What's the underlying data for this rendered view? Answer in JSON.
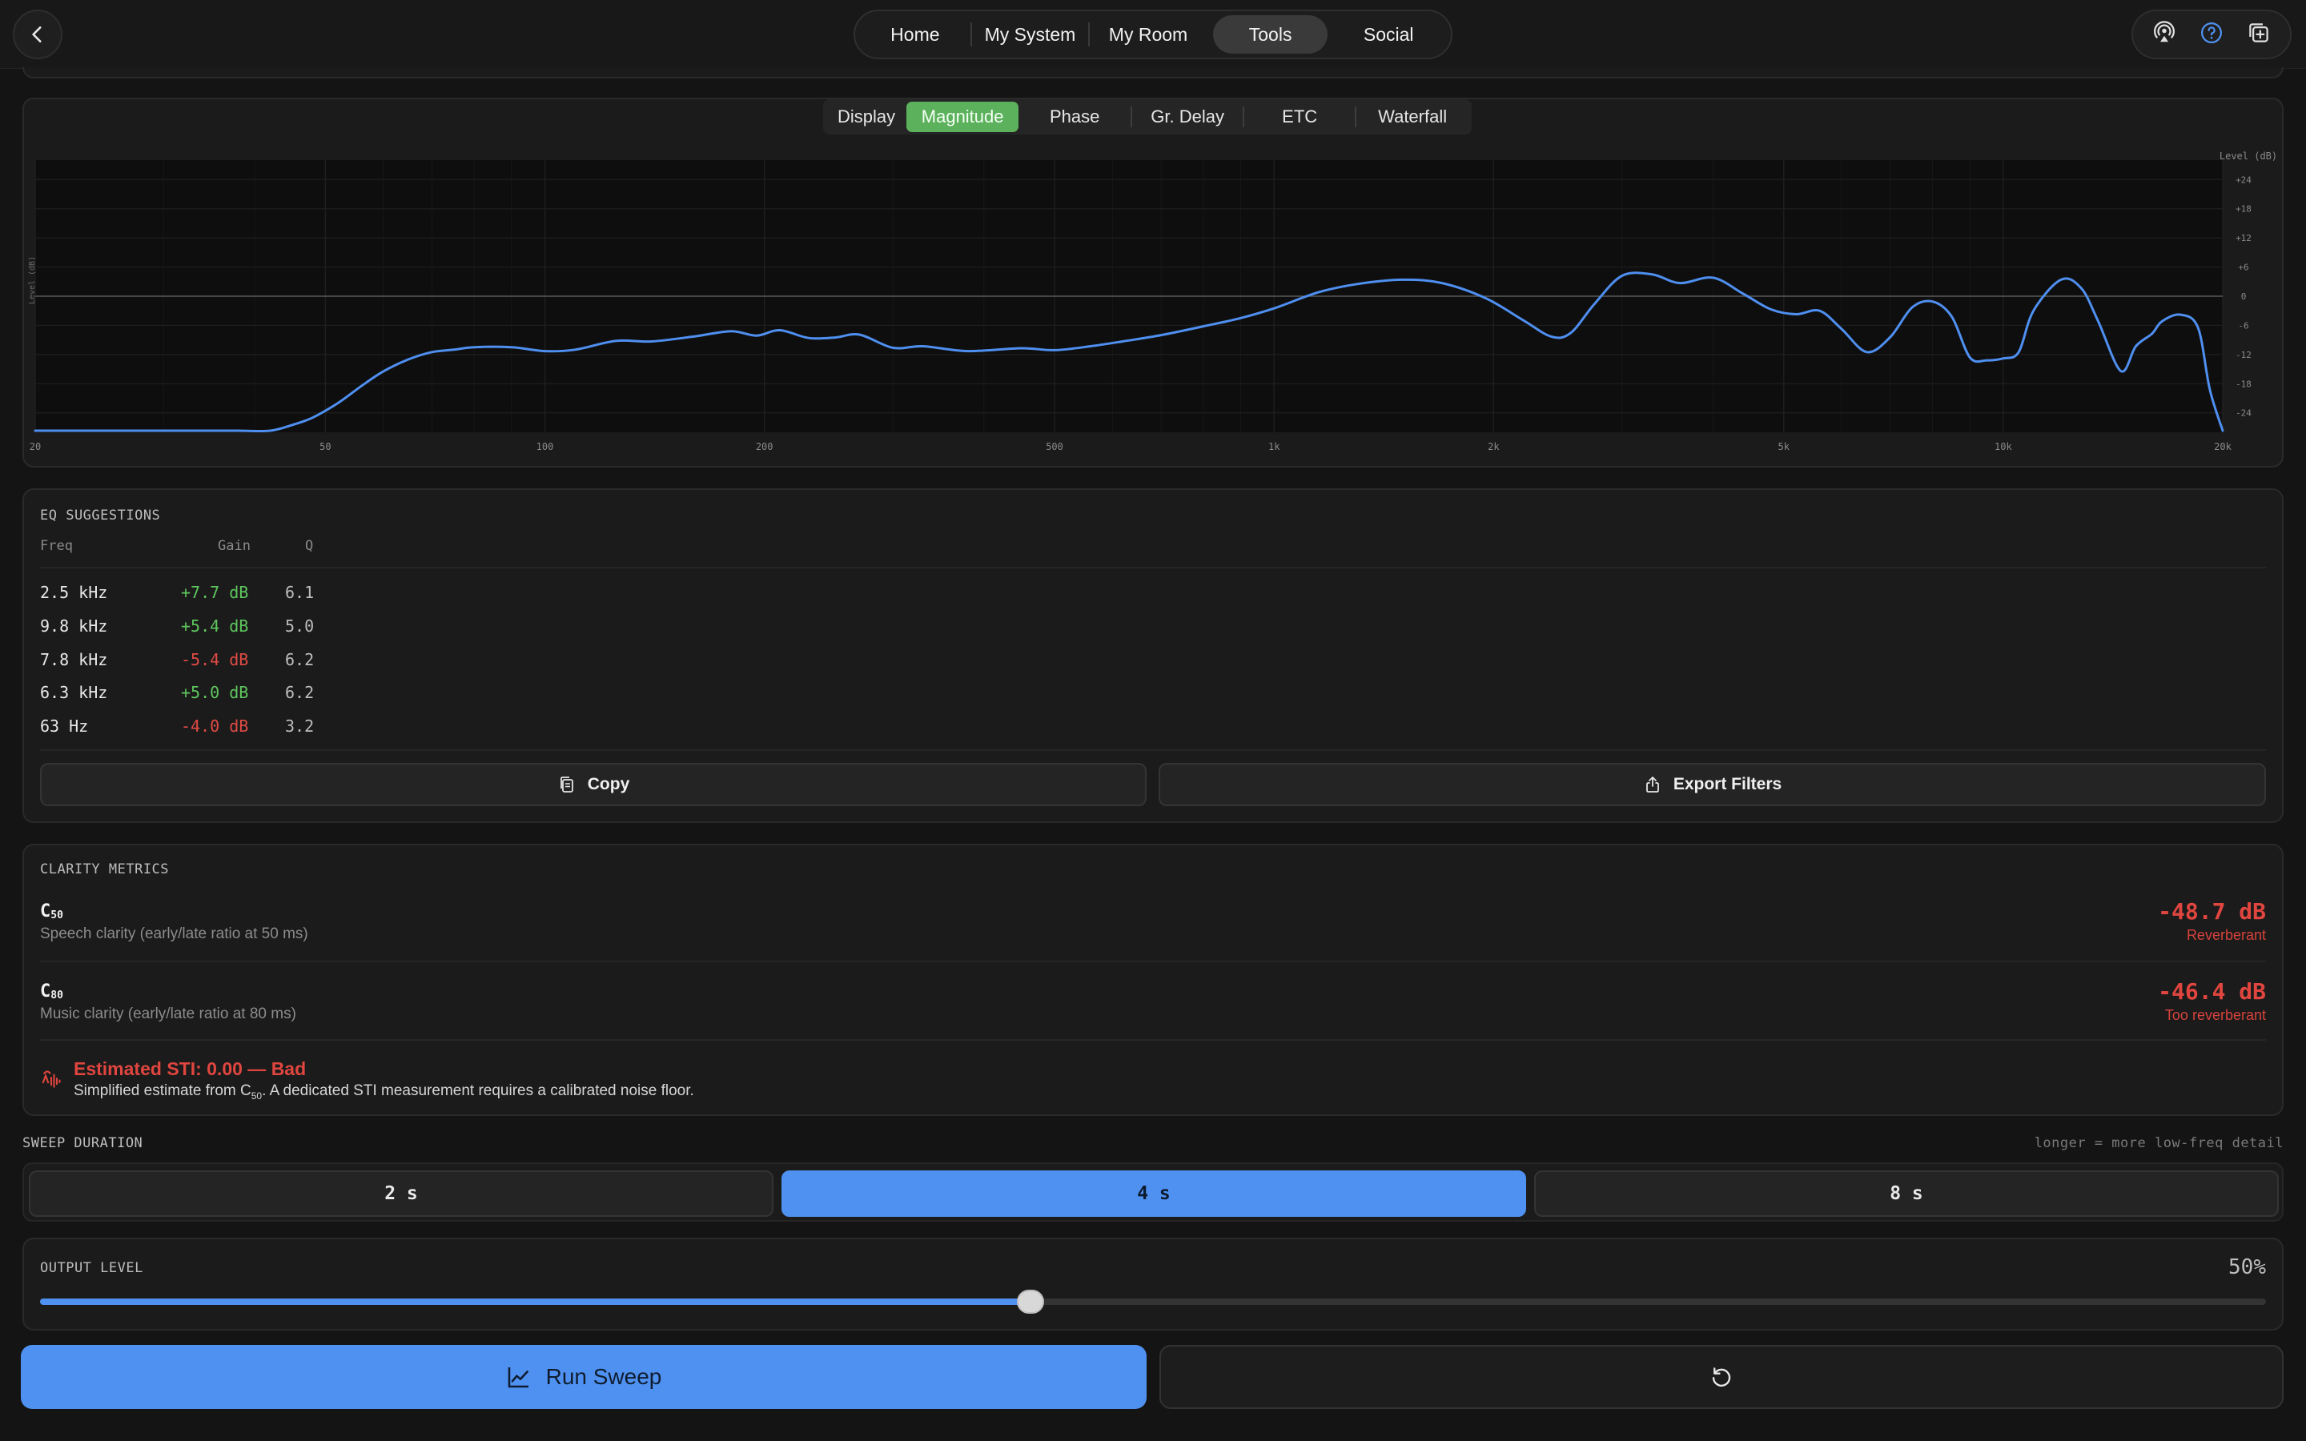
{
  "nav": {
    "tabs": [
      {
        "label": "Home"
      },
      {
        "label": "My System"
      },
      {
        "label": "My Room"
      },
      {
        "label": "Tools",
        "active": true
      },
      {
        "label": "Social"
      }
    ],
    "icons": [
      "airplay-icon",
      "help-icon",
      "add-window-icon"
    ],
    "back_icon": "chevron-left-icon"
  },
  "display": {
    "label": "Display",
    "tabs": [
      {
        "label": "Magnitude",
        "active": true
      },
      {
        "label": "Phase"
      },
      {
        "label": "Gr. Delay"
      },
      {
        "label": "ETC"
      },
      {
        "label": "Waterfall"
      }
    ]
  },
  "chart_data": {
    "type": "line",
    "xscale": "log",
    "xlim": [
      20,
      20000
    ],
    "ylim": [
      -28,
      28
    ],
    "ylabel": "Level (dB)",
    "ylabel_right": "Level (dB)",
    "xticks": [
      {
        "v": 20,
        "label": "20"
      },
      {
        "v": 50,
        "label": "50"
      },
      {
        "v": 100,
        "label": "100"
      },
      {
        "v": 200,
        "label": "200"
      },
      {
        "v": 500,
        "label": "500"
      },
      {
        "v": 1000,
        "label": "1k"
      },
      {
        "v": 2000,
        "label": "2k"
      },
      {
        "v": 5000,
        "label": "5k"
      },
      {
        "v": 10000,
        "label": "10k"
      },
      {
        "v": 20000,
        "label": "20k"
      }
    ],
    "yticks": [
      {
        "v": 24,
        "label": "+24"
      },
      {
        "v": 18,
        "label": "+18"
      },
      {
        "v": 12,
        "label": "+12"
      },
      {
        "v": 6,
        "label": "+6"
      },
      {
        "v": 0,
        "label": "0"
      },
      {
        "v": -6,
        "label": "-6"
      },
      {
        "v": -12,
        "label": "-12"
      },
      {
        "v": -18,
        "label": "-18"
      },
      {
        "v": -24,
        "label": "-24"
      }
    ],
    "color": "#4f8ff0",
    "series": [
      {
        "x": [
          20,
          28,
          35,
          38,
          42,
          45,
          48,
          52,
          56,
          60,
          65,
          70,
          75,
          80,
          90,
          100,
          110,
          125,
          140,
          160,
          180,
          195,
          210,
          230,
          250,
          270,
          300,
          330,
          380,
          450,
          500,
          560,
          620,
          700,
          800,
          900,
          1000,
          1150,
          1300,
          1500,
          1700,
          1950,
          2200,
          2400,
          2550,
          2750,
          3000,
          3300,
          3600,
          4000,
          4400,
          4800,
          5200,
          5600,
          6000,
          6500,
          7000,
          7500,
          8000,
          8500,
          9000,
          9500,
          10000,
          10500,
          11000,
          12000,
          12800,
          13500,
          14500,
          15200,
          16000,
          16500,
          17500,
          18500,
          19200,
          20000
        ],
        "y": [
          -30,
          -30,
          -30,
          -29.5,
          -28,
          -26.5,
          -25,
          -22,
          -18.5,
          -15.5,
          -13,
          -11.5,
          -11,
          -10.5,
          -10.5,
          -11.3,
          -11,
          -9.2,
          -9.3,
          -8.3,
          -7.2,
          -8.1,
          -7.0,
          -8.6,
          -8.5,
          -7.9,
          -10.6,
          -10.3,
          -11.3,
          -10.7,
          -11.1,
          -10.3,
          -9.3,
          -8.0,
          -6.2,
          -4.5,
          -2.5,
          0.8,
          2.5,
          3.4,
          2.7,
          -0.4,
          -5,
          -8.3,
          -7.6,
          -1.6,
          4.2,
          4.5,
          2.7,
          3.8,
          0.5,
          -2.7,
          -3.7,
          -3.0,
          -6.7,
          -11.5,
          -8.4,
          -2.3,
          -1.1,
          -4.2,
          -12.6,
          -13.2,
          -12.8,
          -11.5,
          -3,
          3.4,
          1.6,
          -5.2,
          -15.4,
          -10.3,
          -7.7,
          -5.2,
          -3.8,
          -6.5,
          -19.2,
          -30
        ]
      }
    ]
  },
  "eq": {
    "title": "EQ SUGGESTIONS",
    "headers": {
      "freq": "Freq",
      "gain": "Gain",
      "q": "Q"
    },
    "rows": [
      {
        "freq": "2.5 kHz",
        "gain": "+7.7 dB",
        "q": "6.1",
        "sign": "pos"
      },
      {
        "freq": "9.8 kHz",
        "gain": "+5.4 dB",
        "q": "5.0",
        "sign": "pos"
      },
      {
        "freq": "7.8 kHz",
        "gain": "-5.4 dB",
        "q": "6.2",
        "sign": "neg"
      },
      {
        "freq": "6.3 kHz",
        "gain": "+5.0 dB",
        "q": "6.2",
        "sign": "pos"
      },
      {
        "freq": "63 Hz",
        "gain": "-4.0 dB",
        "q": "3.2",
        "sign": "neg"
      }
    ],
    "copy_label": "Copy",
    "export_label": "Export Filters"
  },
  "clarity": {
    "title": "CLARITY METRICS",
    "c50": {
      "base": "C",
      "sub": "50",
      "desc": "Speech clarity (early/late ratio at 50 ms)",
      "value": "-48.7 dB",
      "tag": "Reverberant"
    },
    "c80": {
      "base": "C",
      "sub": "80",
      "desc": "Music clarity (early/late ratio at 80 ms)",
      "value": "-46.4 dB",
      "tag": "Too reverberant"
    },
    "sti": {
      "title": "Estimated STI: 0.00 — Bad",
      "desc_a": "Simplified estimate from C",
      "desc_sub": "50",
      "desc_b": ". A dedicated STI measurement requires a calibrated noise floor."
    }
  },
  "sweep": {
    "title": "SWEEP DURATION",
    "hint": "longer = more low-freq detail",
    "options": [
      {
        "label": "2 s"
      },
      {
        "label": "4 s",
        "active": true
      },
      {
        "label": "8 s"
      }
    ]
  },
  "output": {
    "title": "OUTPUT LEVEL",
    "value_label": "50%",
    "level": 0.445
  },
  "actions": {
    "run_label": "Run Sweep"
  },
  "colors": {
    "accent_blue": "#4f91f0",
    "accent_green": "#5cb15c",
    "danger_red": "#e0463f",
    "positive_green": "#5ec75e"
  }
}
